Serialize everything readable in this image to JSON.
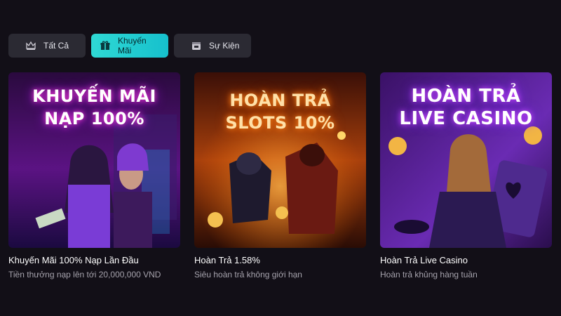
{
  "tabs": [
    {
      "label": "Tất Cả",
      "icon": "crown-icon"
    },
    {
      "label": "Khuyến Mãi",
      "icon": "gift-icon"
    },
    {
      "label": "Sự Kiện",
      "icon": "calendar-icon"
    }
  ],
  "colors": {
    "active_tab": "#22cfd1",
    "background": "#120f17",
    "tab_bg": "#2b2a33"
  },
  "promotions": [
    {
      "headline_line1": "KHUYẾN MÃI",
      "headline_line2": "NẠP 100%",
      "title": "Khuyến Mãi 100% Nạp Lần Đầu",
      "subtitle": "Tiền thưởng nạp lên tới 20,000,000 VND"
    },
    {
      "headline_line1": "HOÀN TRẢ",
      "headline_line2": "SLOTS 10%",
      "title": "Hoàn Trả 1.58%",
      "subtitle": "Siêu hoàn trả không giới hạn"
    },
    {
      "headline_line1": "HOÀN TRẢ",
      "headline_line2": "LIVE CASINO",
      "title": "Hoàn Trả Live Casino",
      "subtitle": "Hoàn trả khủng hàng tuần"
    }
  ]
}
